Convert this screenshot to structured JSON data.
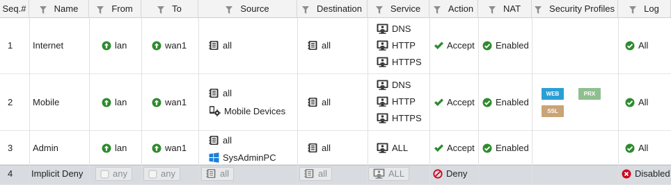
{
  "columns": [
    {
      "label": "Seq.#",
      "filter": false
    },
    {
      "label": "Name",
      "filter": true
    },
    {
      "label": "From",
      "filter": true
    },
    {
      "label": "To",
      "filter": true
    },
    {
      "label": "Source",
      "filter": true
    },
    {
      "label": "Destination",
      "filter": true
    },
    {
      "label": "Service",
      "filter": true
    },
    {
      "label": "Action",
      "filter": true
    },
    {
      "label": "NAT",
      "filter": true
    },
    {
      "label": "Security Profiles",
      "filter": true
    },
    {
      "label": "Log",
      "filter": true
    }
  ],
  "rows": [
    {
      "seq": "1",
      "name": "Internet",
      "from": "lan",
      "to": "wan1",
      "source": [
        "all"
      ],
      "destination": "all",
      "service": [
        "DNS",
        "HTTP",
        "HTTPS"
      ],
      "action": "Accept",
      "nat": "Enabled",
      "profiles": [],
      "log": "All"
    },
    {
      "seq": "2",
      "name": "Mobile",
      "from": "lan",
      "to": "wan1",
      "source": [
        "all",
        "Mobile Devices"
      ],
      "destination": "all",
      "service": [
        "DNS",
        "HTTP",
        "HTTPS"
      ],
      "action": "Accept",
      "nat": "Enabled",
      "profiles": [
        "WEB",
        "PRX",
        "SSL"
      ],
      "log": "All"
    },
    {
      "seq": "3",
      "name": "Admin",
      "from": "lan",
      "to": "wan1",
      "source": [
        "all",
        "SysAdminPC"
      ],
      "destination": "all",
      "service": [
        "ALL"
      ],
      "action": "Accept",
      "nat": "Enabled",
      "profiles": [],
      "log": "All"
    },
    {
      "seq": "4",
      "name": "Implicit Deny",
      "from": "any",
      "to": "any",
      "source": [
        "all"
      ],
      "destination": "all",
      "service": [
        "ALL"
      ],
      "action": "Deny",
      "nat": "",
      "profiles": [],
      "log": "Disabled"
    }
  ],
  "colors": {
    "accept": "#2e8b2e",
    "deny": "#d0021b",
    "web": "#2a9fd6",
    "prx": "#8fbf8f",
    "ssl": "#c8a476"
  },
  "icons": {
    "interface": "arrow-up-circle-icon",
    "address": "address-book-icon",
    "service": "service-monitor-icon",
    "device": "mobile-devices-icon",
    "windows": "windows-icon",
    "accept": "checkmark-icon",
    "nat": "check-circle-icon",
    "log": "check-circle-icon",
    "deny": "no-entry-icon",
    "disabled": "x-circle-icon",
    "filter": "funnel-icon"
  }
}
